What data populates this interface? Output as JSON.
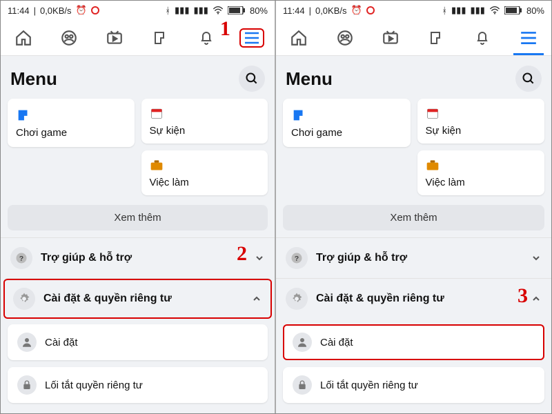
{
  "status": {
    "time": "11:44",
    "net": "0,0KB/s",
    "battery": "80%"
  },
  "header": {
    "title": "Menu"
  },
  "cards": {
    "gaming": "Chơi game",
    "events": "Sự kiện",
    "jobs": "Việc làm"
  },
  "see_more": "Xem thêm",
  "rows": {
    "help": "Trợ giúp & hỗ trợ",
    "settings": "Cài đặt & quyền riêng tư"
  },
  "sub": {
    "settings": "Cài đặt",
    "privacy_shortcut": "Lối tắt quyền riêng tư"
  },
  "annot": {
    "one": "1",
    "two": "2",
    "three": "3"
  }
}
